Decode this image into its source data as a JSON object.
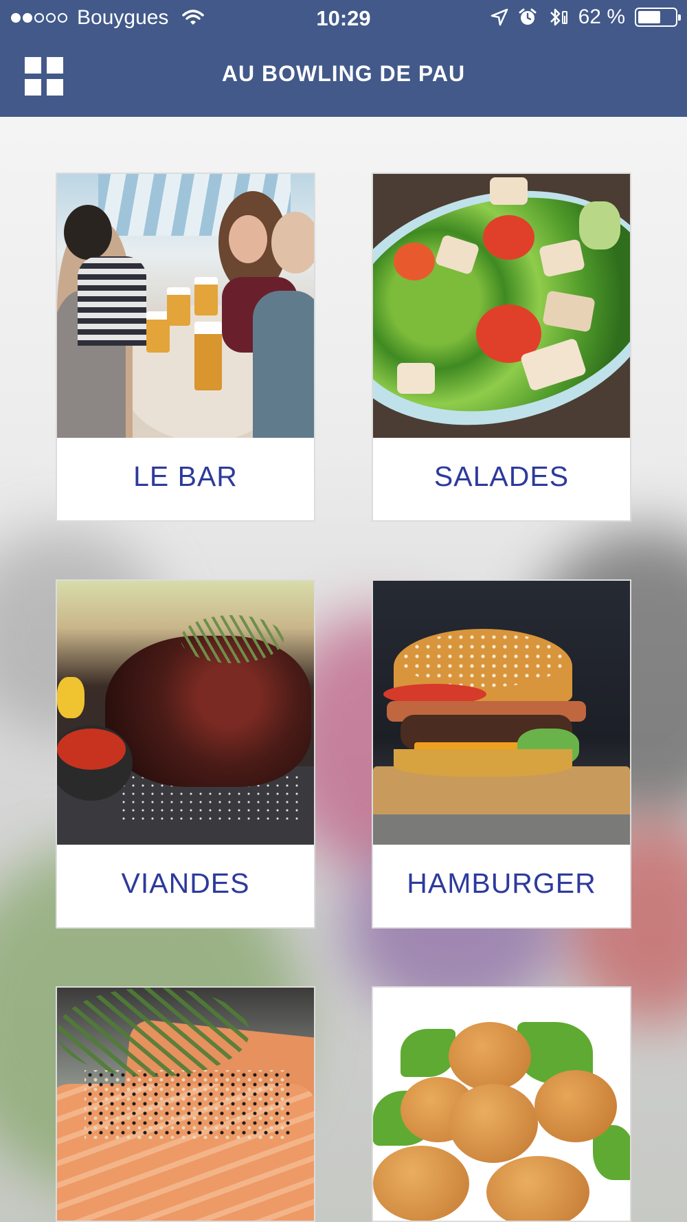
{
  "status_bar": {
    "carrier": "Bouygues",
    "signal_bars": 2,
    "time": "10:29",
    "battery_text": "62 %",
    "battery_level": 0.62
  },
  "header": {
    "title": "AU BOWLING DE PAU",
    "menu_icon": "grid-menu-icon",
    "background_color": "#42598a"
  },
  "categories": [
    {
      "label": "LE BAR",
      "image": "friends-drinking-beer-photo"
    },
    {
      "label": "SALADES",
      "image": "chicken-salad-photo"
    },
    {
      "label": "VIANDES",
      "image": "grilled-steak-photo"
    },
    {
      "label": "HAMBURGER",
      "image": "hamburger-photo"
    },
    {
      "label": "",
      "image": "salmon-fillet-photo"
    },
    {
      "label": "",
      "image": "chicken-nuggets-photo"
    }
  ],
  "colors": {
    "label_text": "#2d3a9c",
    "tile_background": "#ffffff"
  }
}
